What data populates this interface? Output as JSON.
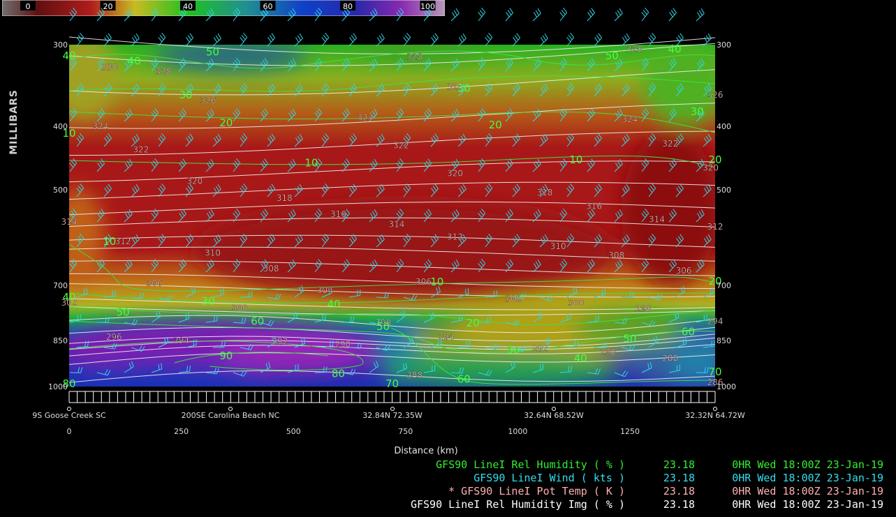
{
  "colorbar": {
    "ticks": [
      "0",
      "20",
      "40",
      "60",
      "80",
      "100"
    ],
    "stops": [
      "#6b6b6b",
      "#5a1010",
      "#b02020",
      "#c8c020",
      "#20c020",
      "#208080",
      "#1040c0",
      "#2020a0",
      "#8020a0",
      "#b080b0"
    ]
  },
  "yaxis": {
    "title": "MILLIBARS",
    "ticks": [
      "300",
      "400",
      "500",
      "700",
      "850",
      "1000"
    ]
  },
  "xaxis": {
    "title": "Distance (km)",
    "location_labels": [
      "9S Goose Creek SC",
      "200SE Carolina Beach NC",
      "32.84N 72.35W",
      "32.64N 68.52W",
      "32.32N 64.72W"
    ],
    "distance_ticks": [
      "0",
      "250",
      "500",
      "750",
      "1000",
      "1250"
    ]
  },
  "legend": [
    {
      "name": "GFS90 LineI Rel Humidity ( % )",
      "value": "23.18",
      "time": "0HR Wed 18:00Z 23-Jan-19",
      "color": "#33ee33"
    },
    {
      "name": "GFS90 LineI Wind ( kts )",
      "value": "23.18",
      "time": "0HR Wed 18:00Z 23-Jan-19",
      "color": "#33ddee"
    },
    {
      "name": "* GFS90 LineI Pot Temp ( K )",
      "value": "23.18",
      "time": "0HR Wed 18:00Z 23-Jan-19",
      "color": "#ffb0b0"
    },
    {
      "name": "GFS90 LineI Rel Humidity Img ( % )",
      "value": "23.18",
      "time": "0HR Wed 18:00Z 23-Jan-19",
      "color": "#ffffff"
    }
  ],
  "chart_data": {
    "type": "heatmap",
    "description_fields": "cross-section of relative humidity (filled), potential temperature (white contours), RH contours (green) and wind barbs (cyan)",
    "xlabel": "Distance (km)",
    "ylabel": "MILLIBARS",
    "xlim": [
      0,
      1440
    ],
    "ylim": [
      1000,
      300
    ],
    "rh_fill_colors": {
      "dry": "#b01818",
      "moist_mid": "#c0b818",
      "moist": "#20b020",
      "saturated_low": "#2040c0",
      "very_saturated": "#8020b0"
    },
    "theta_labels": [
      {
        "x": 90,
        "p": 325,
        "v": "330"
      },
      {
        "x": 1260,
        "p": 305,
        "v": "328"
      },
      {
        "x": 770,
        "p": 313,
        "v": "328"
      },
      {
        "x": 210,
        "p": 330,
        "v": "328"
      },
      {
        "x": 860,
        "p": 348,
        "v": "326"
      },
      {
        "x": 310,
        "p": 365,
        "v": "326"
      },
      {
        "x": 1440,
        "p": 358,
        "v": "326"
      },
      {
        "x": 70,
        "p": 400,
        "v": "324"
      },
      {
        "x": 660,
        "p": 388,
        "v": "324"
      },
      {
        "x": 1250,
        "p": 390,
        "v": "324"
      },
      {
        "x": 160,
        "p": 434,
        "v": "322"
      },
      {
        "x": 740,
        "p": 428,
        "v": "322"
      },
      {
        "x": 1340,
        "p": 425,
        "v": "322"
      },
      {
        "x": 280,
        "p": 485,
        "v": "320"
      },
      {
        "x": 860,
        "p": 472,
        "v": "320"
      },
      {
        "x": 1430,
        "p": 463,
        "v": "320"
      },
      {
        "x": 480,
        "p": 515,
        "v": "318"
      },
      {
        "x": 1060,
        "p": 505,
        "v": "318"
      },
      {
        "x": 600,
        "p": 545,
        "v": "316"
      },
      {
        "x": 1170,
        "p": 530,
        "v": "316"
      },
      {
        "x": 0,
        "p": 560,
        "v": "314"
      },
      {
        "x": 730,
        "p": 565,
        "v": "314"
      },
      {
        "x": 1310,
        "p": 555,
        "v": "314"
      },
      {
        "x": 120,
        "p": 600,
        "v": "312"
      },
      {
        "x": 860,
        "p": 590,
        "v": "312"
      },
      {
        "x": 1440,
        "p": 570,
        "v": "312"
      },
      {
        "x": 320,
        "p": 625,
        "v": "310"
      },
      {
        "x": 1090,
        "p": 610,
        "v": "310"
      },
      {
        "x": 450,
        "p": 660,
        "v": "308"
      },
      {
        "x": 1220,
        "p": 630,
        "v": "308"
      },
      {
        "x": 190,
        "p": 695,
        "v": "306"
      },
      {
        "x": 790,
        "p": 692,
        "v": "306"
      },
      {
        "x": 1370,
        "p": 665,
        "v": "306"
      },
      {
        "x": 570,
        "p": 712,
        "v": "304"
      },
      {
        "x": 0,
        "p": 745,
        "v": "302"
      },
      {
        "x": 990,
        "p": 735,
        "v": "302"
      },
      {
        "x": 380,
        "p": 758,
        "v": "300"
      },
      {
        "x": 1130,
        "p": 745,
        "v": "300"
      },
      {
        "x": 700,
        "p": 800,
        "v": "298"
      },
      {
        "x": 1280,
        "p": 760,
        "v": "298"
      },
      {
        "x": 1440,
        "p": 795,
        "v": "294"
      },
      {
        "x": 100,
        "p": 840,
        "v": "296"
      },
      {
        "x": 250,
        "p": 850,
        "v": "294"
      },
      {
        "x": 840,
        "p": 840,
        "v": "294"
      },
      {
        "x": 470,
        "p": 853,
        "v": "292"
      },
      {
        "x": 1050,
        "p": 875,
        "v": "292"
      },
      {
        "x": 610,
        "p": 862,
        "v": "290"
      },
      {
        "x": 1200,
        "p": 885,
        "v": "290"
      },
      {
        "x": 1340,
        "p": 905,
        "v": "288"
      },
      {
        "x": 770,
        "p": 960,
        "v": "288"
      },
      {
        "x": 1440,
        "p": 985,
        "v": "286"
      }
    ],
    "rh_labels": [
      {
        "x": 0,
        "p": 312,
        "v": "40"
      },
      {
        "x": 145,
        "p": 318,
        "v": "40"
      },
      {
        "x": 320,
        "p": 308,
        "v": "50"
      },
      {
        "x": 1210,
        "p": 312,
        "v": "50"
      },
      {
        "x": 1350,
        "p": 305,
        "v": "40"
      },
      {
        "x": 880,
        "p": 350,
        "v": "30"
      },
      {
        "x": 260,
        "p": 358,
        "v": "30"
      },
      {
        "x": 1400,
        "p": 380,
        "v": "30"
      },
      {
        "x": 350,
        "p": 395,
        "v": "20"
      },
      {
        "x": 950,
        "p": 398,
        "v": "20"
      },
      {
        "x": 0,
        "p": 410,
        "v": "10"
      },
      {
        "x": 540,
        "p": 455,
        "v": "10"
      },
      {
        "x": 1130,
        "p": 450,
        "v": "10"
      },
      {
        "x": 1440,
        "p": 450,
        "v": "20"
      },
      {
        "x": 90,
        "p": 600,
        "v": "10"
      },
      {
        "x": 820,
        "p": 692,
        "v": "10"
      },
      {
        "x": 1440,
        "p": 690,
        "v": "20"
      },
      {
        "x": 0,
        "p": 730,
        "v": "40"
      },
      {
        "x": 310,
        "p": 740,
        "v": "30"
      },
      {
        "x": 590,
        "p": 748,
        "v": "40"
      },
      {
        "x": 120,
        "p": 770,
        "v": "50"
      },
      {
        "x": 420,
        "p": 795,
        "v": "60"
      },
      {
        "x": 700,
        "p": 810,
        "v": "50"
      },
      {
        "x": 900,
        "p": 800,
        "v": "20"
      },
      {
        "x": 1380,
        "p": 825,
        "v": "60"
      },
      {
        "x": 1250,
        "p": 845,
        "v": "50"
      },
      {
        "x": 990,
        "p": 880,
        "v": "30"
      },
      {
        "x": 1140,
        "p": 905,
        "v": "40"
      },
      {
        "x": 350,
        "p": 898,
        "v": "90"
      },
      {
        "x": 600,
        "p": 955,
        "v": "80"
      },
      {
        "x": 1440,
        "p": 950,
        "v": "70"
      },
      {
        "x": 0,
        "p": 990,
        "v": "80"
      },
      {
        "x": 720,
        "p": 990,
        "v": "70"
      },
      {
        "x": 880,
        "p": 975,
        "v": "60"
      }
    ]
  }
}
